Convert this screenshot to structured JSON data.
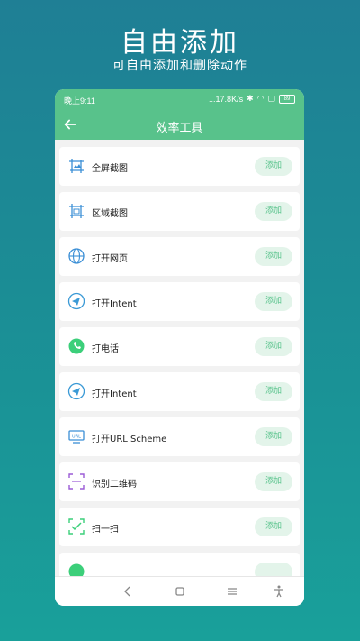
{
  "hero": {
    "title": "自由添加",
    "subtitle": "可自由添加和删除动作"
  },
  "statusbar": {
    "time": "晚上9:11",
    "network": "...17.8K/s",
    "battery": "89"
  },
  "appbar": {
    "title": "效率工具",
    "back_icon": "arrow-left-icon"
  },
  "items": [
    {
      "label": "全屏截图",
      "button": "添加",
      "icon": "screenshot-full-icon",
      "color": "#3b8fd6"
    },
    {
      "label": "区域截图",
      "button": "添加",
      "icon": "screenshot-area-icon",
      "color": "#3b8fd6"
    },
    {
      "label": "打开网页",
      "button": "添加",
      "icon": "globe-icon",
      "color": "#3b8fd6"
    },
    {
      "label": "打开Intent",
      "button": "添加",
      "icon": "send-icon",
      "color": "#3b9ad6"
    },
    {
      "label": "打电话",
      "button": "添加",
      "icon": "phone-icon",
      "color": "#3ccf7a"
    },
    {
      "label": "打开Intent",
      "button": "添加",
      "icon": "send-icon",
      "color": "#3b9ad6"
    },
    {
      "label": "打开URL Scheme",
      "button": "添加",
      "icon": "url-icon",
      "color": "#3b8fd6"
    },
    {
      "label": "识别二维码",
      "button": "添加",
      "icon": "qr-scan-icon",
      "color": "#9b5bd6"
    },
    {
      "label": "扫一扫",
      "button": "添加",
      "icon": "scan-check-icon",
      "color": "#3ccf7a"
    },
    {
      "label": "",
      "button": "",
      "icon": "partial-item-icon",
      "color": "#3ccf7a"
    }
  ],
  "colors": {
    "accent": "#58c28b",
    "button_bg": "#e3f4ea",
    "button_text": "#59c38c"
  },
  "navbar": {
    "icons": [
      "back-nav-icon",
      "home-nav-icon",
      "menu-nav-icon",
      "accessibility-icon"
    ]
  }
}
